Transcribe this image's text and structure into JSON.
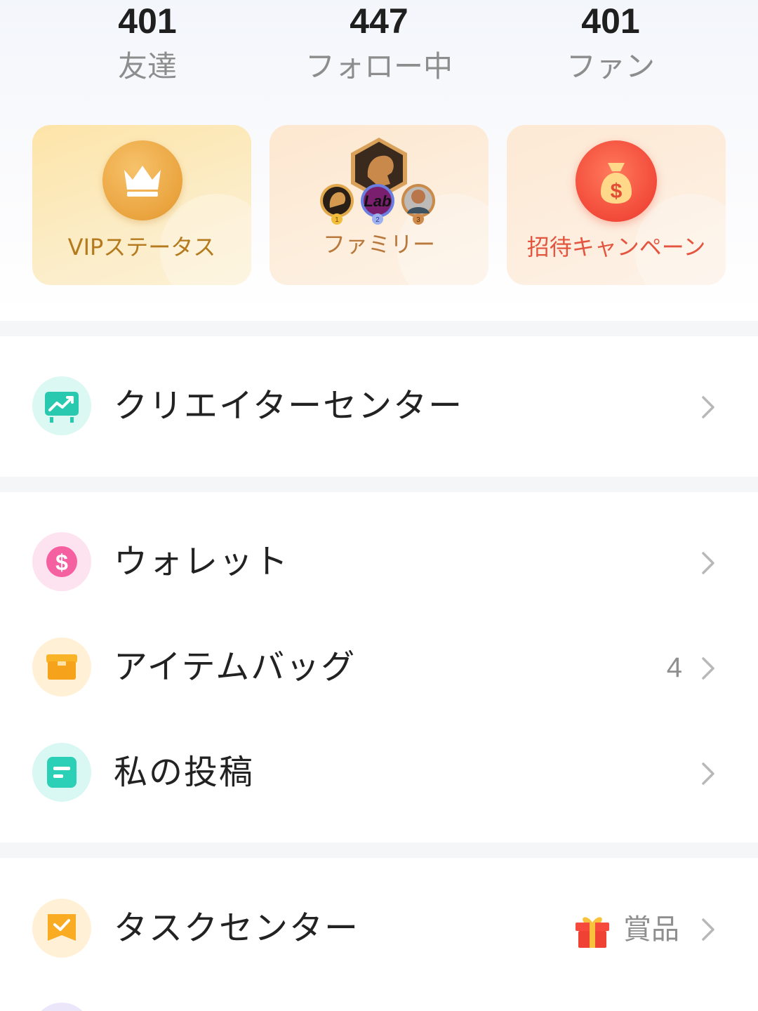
{
  "stats": [
    {
      "value": "401",
      "label": "友達"
    },
    {
      "value": "447",
      "label": "フォロー中"
    },
    {
      "value": "401",
      "label": "ファン"
    }
  ],
  "cards": {
    "vip": {
      "label": "VIPステータス",
      "icon": "crown-icon"
    },
    "family": {
      "label": "ファミリー",
      "icon": "family-badge-icon",
      "badges": [
        "1",
        "2",
        "3"
      ],
      "lab_text": "Lab"
    },
    "invite": {
      "label": "招待キャンペーン",
      "icon": "money-bag-icon"
    }
  },
  "menu": {
    "creator": {
      "label": "クリエイターセンター",
      "icon": "analytics-icon"
    },
    "wallet": {
      "label": "ウォレット",
      "icon": "dollar-icon"
    },
    "itembag": {
      "label": "アイテムバッグ",
      "icon": "box-icon",
      "count": "4"
    },
    "posts": {
      "label": "私の投稿",
      "icon": "note-icon"
    },
    "tasks": {
      "label": "タスクセンター",
      "icon": "task-icon",
      "reward_label": "賞品"
    }
  },
  "colors": {
    "vip_text": "#b57a1e",
    "family_text": "#b9783c",
    "invite_text": "#e4553f",
    "divider": "#f5f6f8"
  }
}
